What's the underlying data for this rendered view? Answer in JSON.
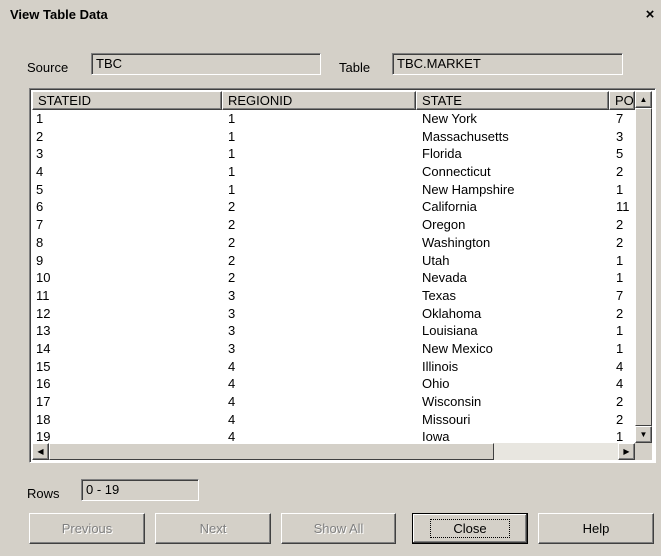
{
  "window": {
    "title": "View Table Data",
    "close_glyph": "×"
  },
  "source": {
    "label": "Source",
    "value": "TBC"
  },
  "table": {
    "label": "Table",
    "value": "TBC.MARKET"
  },
  "grid": {
    "columns": [
      "STATEID",
      "REGIONID",
      "STATE",
      "PO"
    ],
    "rows": [
      [
        "1",
        "1",
        "New York",
        "7"
      ],
      [
        "2",
        "1",
        "Massachusetts",
        "3"
      ],
      [
        "3",
        "1",
        "Florida",
        "5"
      ],
      [
        "4",
        "1",
        "Connecticut",
        "2"
      ],
      [
        "5",
        "1",
        "New Hampshire",
        "1"
      ],
      [
        "6",
        "2",
        "California",
        "11"
      ],
      [
        "7",
        "2",
        "Oregon",
        "2"
      ],
      [
        "8",
        "2",
        "Washington",
        "2"
      ],
      [
        "9",
        "2",
        "Utah",
        "1"
      ],
      [
        "10",
        "2",
        "Nevada",
        "1"
      ],
      [
        "11",
        "3",
        "Texas",
        "7"
      ],
      [
        "12",
        "3",
        "Oklahoma",
        "2"
      ],
      [
        "13",
        "3",
        "Louisiana",
        "1"
      ],
      [
        "14",
        "3",
        "New Mexico",
        "1"
      ],
      [
        "15",
        "4",
        "Illinois",
        "4"
      ],
      [
        "16",
        "4",
        "Ohio",
        "4"
      ],
      [
        "17",
        "4",
        "Wisconsin",
        "2"
      ],
      [
        "18",
        "4",
        "Missouri",
        "2"
      ],
      [
        "19",
        "4",
        "Iowa",
        "1"
      ]
    ]
  },
  "rows_info": {
    "label": "Rows",
    "value": "0 - 19"
  },
  "buttons": {
    "previous": "Previous",
    "next": "Next",
    "show_all": "Show All",
    "close": "Close",
    "help": "Help"
  },
  "icons": {
    "scroll_up": "arrow-up-icon",
    "scroll_down": "arrow-down-icon",
    "scroll_left": "arrow-left-icon",
    "scroll_right": "arrow-right-icon"
  }
}
